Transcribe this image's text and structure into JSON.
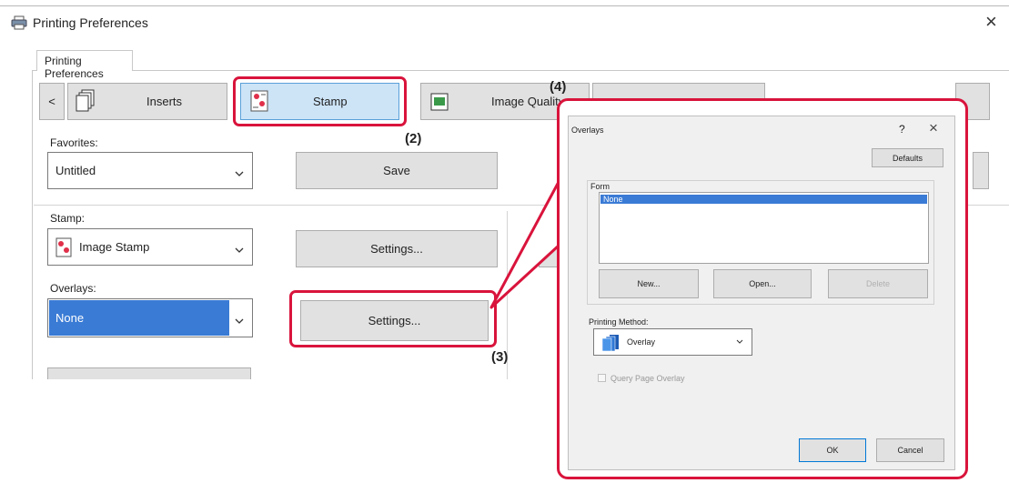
{
  "window": {
    "title": "Printing Preferences",
    "close_glyph": "×",
    "tab_label": "Printing Preferences"
  },
  "toolbar": {
    "back_glyph": "<",
    "inserts_label": "Inserts",
    "stamp_label": "Stamp",
    "image_quality_label": "Image Quality"
  },
  "favorites": {
    "label": "Favorites:",
    "value": "Untitled",
    "save_label": "Save"
  },
  "stamp": {
    "label": "Stamp:",
    "value": "Image Stamp",
    "settings_label": "Settings..."
  },
  "overlays": {
    "label": "Overlays:",
    "value": "None",
    "settings_label": "Settings..."
  },
  "callouts": {
    "c2": "(2)",
    "c3": "(3)",
    "c4": "(4)"
  },
  "dialog": {
    "title": "Overlays",
    "help_glyph": "?",
    "close_glyph": "×",
    "defaults_label": "Defaults",
    "form_label": "Form",
    "form_items": [
      "None"
    ],
    "new_label": "New...",
    "open_label": "Open...",
    "delete_label": "Delete",
    "printing_method_label": "Printing Method:",
    "printing_method_value": "Overlay",
    "query_label": "Query Page Overlay",
    "ok_label": "OK",
    "cancel_label": "Cancel"
  },
  "colors": {
    "highlight_red": "#d9143c",
    "selection_blue": "#3a7bd5",
    "stamp_tab_blue": "#cde4f7"
  }
}
